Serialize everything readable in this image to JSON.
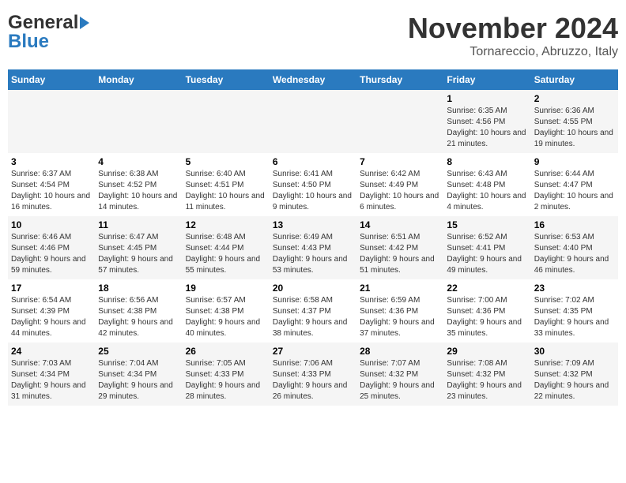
{
  "logo": {
    "general": "General",
    "blue": "Blue"
  },
  "title": "November 2024",
  "location": "Tornareccio, Abruzzo, Italy",
  "days_of_week": [
    "Sunday",
    "Monday",
    "Tuesday",
    "Wednesday",
    "Thursday",
    "Friday",
    "Saturday"
  ],
  "weeks": [
    [
      {
        "day": "",
        "info": ""
      },
      {
        "day": "",
        "info": ""
      },
      {
        "day": "",
        "info": ""
      },
      {
        "day": "",
        "info": ""
      },
      {
        "day": "",
        "info": ""
      },
      {
        "day": "1",
        "info": "Sunrise: 6:35 AM\nSunset: 4:56 PM\nDaylight: 10 hours and 21 minutes."
      },
      {
        "day": "2",
        "info": "Sunrise: 6:36 AM\nSunset: 4:55 PM\nDaylight: 10 hours and 19 minutes."
      }
    ],
    [
      {
        "day": "3",
        "info": "Sunrise: 6:37 AM\nSunset: 4:54 PM\nDaylight: 10 hours and 16 minutes."
      },
      {
        "day": "4",
        "info": "Sunrise: 6:38 AM\nSunset: 4:52 PM\nDaylight: 10 hours and 14 minutes."
      },
      {
        "day": "5",
        "info": "Sunrise: 6:40 AM\nSunset: 4:51 PM\nDaylight: 10 hours and 11 minutes."
      },
      {
        "day": "6",
        "info": "Sunrise: 6:41 AM\nSunset: 4:50 PM\nDaylight: 10 hours and 9 minutes."
      },
      {
        "day": "7",
        "info": "Sunrise: 6:42 AM\nSunset: 4:49 PM\nDaylight: 10 hours and 6 minutes."
      },
      {
        "day": "8",
        "info": "Sunrise: 6:43 AM\nSunset: 4:48 PM\nDaylight: 10 hours and 4 minutes."
      },
      {
        "day": "9",
        "info": "Sunrise: 6:44 AM\nSunset: 4:47 PM\nDaylight: 10 hours and 2 minutes."
      }
    ],
    [
      {
        "day": "10",
        "info": "Sunrise: 6:46 AM\nSunset: 4:46 PM\nDaylight: 9 hours and 59 minutes."
      },
      {
        "day": "11",
        "info": "Sunrise: 6:47 AM\nSunset: 4:45 PM\nDaylight: 9 hours and 57 minutes."
      },
      {
        "day": "12",
        "info": "Sunrise: 6:48 AM\nSunset: 4:44 PM\nDaylight: 9 hours and 55 minutes."
      },
      {
        "day": "13",
        "info": "Sunrise: 6:49 AM\nSunset: 4:43 PM\nDaylight: 9 hours and 53 minutes."
      },
      {
        "day": "14",
        "info": "Sunrise: 6:51 AM\nSunset: 4:42 PM\nDaylight: 9 hours and 51 minutes."
      },
      {
        "day": "15",
        "info": "Sunrise: 6:52 AM\nSunset: 4:41 PM\nDaylight: 9 hours and 49 minutes."
      },
      {
        "day": "16",
        "info": "Sunrise: 6:53 AM\nSunset: 4:40 PM\nDaylight: 9 hours and 46 minutes."
      }
    ],
    [
      {
        "day": "17",
        "info": "Sunrise: 6:54 AM\nSunset: 4:39 PM\nDaylight: 9 hours and 44 minutes."
      },
      {
        "day": "18",
        "info": "Sunrise: 6:56 AM\nSunset: 4:38 PM\nDaylight: 9 hours and 42 minutes."
      },
      {
        "day": "19",
        "info": "Sunrise: 6:57 AM\nSunset: 4:38 PM\nDaylight: 9 hours and 40 minutes."
      },
      {
        "day": "20",
        "info": "Sunrise: 6:58 AM\nSunset: 4:37 PM\nDaylight: 9 hours and 38 minutes."
      },
      {
        "day": "21",
        "info": "Sunrise: 6:59 AM\nSunset: 4:36 PM\nDaylight: 9 hours and 37 minutes."
      },
      {
        "day": "22",
        "info": "Sunrise: 7:00 AM\nSunset: 4:36 PM\nDaylight: 9 hours and 35 minutes."
      },
      {
        "day": "23",
        "info": "Sunrise: 7:02 AM\nSunset: 4:35 PM\nDaylight: 9 hours and 33 minutes."
      }
    ],
    [
      {
        "day": "24",
        "info": "Sunrise: 7:03 AM\nSunset: 4:34 PM\nDaylight: 9 hours and 31 minutes."
      },
      {
        "day": "25",
        "info": "Sunrise: 7:04 AM\nSunset: 4:34 PM\nDaylight: 9 hours and 29 minutes."
      },
      {
        "day": "26",
        "info": "Sunrise: 7:05 AM\nSunset: 4:33 PM\nDaylight: 9 hours and 28 minutes."
      },
      {
        "day": "27",
        "info": "Sunrise: 7:06 AM\nSunset: 4:33 PM\nDaylight: 9 hours and 26 minutes."
      },
      {
        "day": "28",
        "info": "Sunrise: 7:07 AM\nSunset: 4:32 PM\nDaylight: 9 hours and 25 minutes."
      },
      {
        "day": "29",
        "info": "Sunrise: 7:08 AM\nSunset: 4:32 PM\nDaylight: 9 hours and 23 minutes."
      },
      {
        "day": "30",
        "info": "Sunrise: 7:09 AM\nSunset: 4:32 PM\nDaylight: 9 hours and 22 minutes."
      }
    ]
  ]
}
